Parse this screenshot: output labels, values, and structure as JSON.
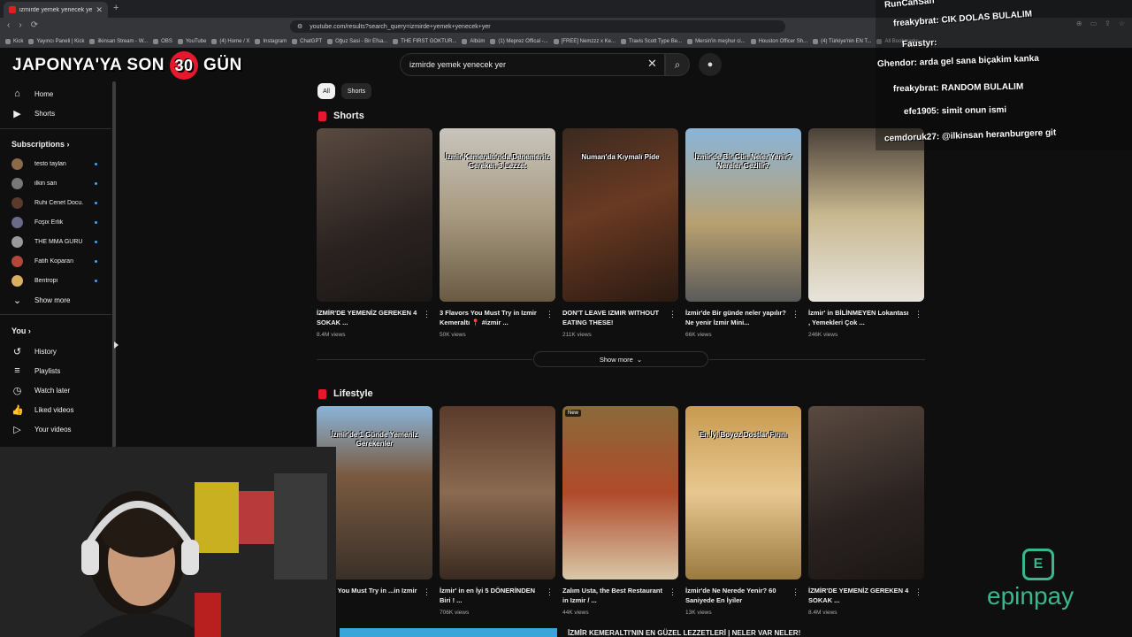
{
  "browser": {
    "tab_title": "izmirde yemek yenecek yer - YouTube",
    "new_tab": "+",
    "url": "youtube.com/results?search_query=izmirde+yemek+yenecek+yer",
    "nav": {
      "back": "‹",
      "forward": "›",
      "reload": "⟳"
    },
    "bookmarks": [
      "Kick",
      "Yayıncı Paneli | Kick",
      "ilkinsan Stream - W...",
      "OBS",
      "YouTube",
      "(4) Home / X",
      "Instagram",
      "ChatGPT",
      "Oğuz Sasi - Bir Efsa...",
      "THE FIRST GOKTUR...",
      "Albüm",
      "(1) Meprez Offical -...",
      "[FREE] Nemzzz x Ke...",
      "Travis Scott Type Be...",
      "Mersin'in meşhur ci...",
      "Houston Officer Sh...",
      "(4) Türkiye'nin EN T...",
      "All Bookmarks"
    ]
  },
  "overlay": {
    "title_left": "JAPONYA'YA SON",
    "title_number": "30",
    "title_right": "GÜN"
  },
  "search": {
    "query": "izmirde yemek yenecek yer",
    "clear": "✕",
    "search_icon": "⌕",
    "mic_icon": "🎤"
  },
  "sidebar": {
    "home": "Home",
    "shorts": "Shorts",
    "subscriptions": "Subscriptions",
    "subs": [
      {
        "name": "testo taylan",
        "color": "#8a6a4a"
      },
      {
        "name": "ilkin san",
        "color": "#777777"
      },
      {
        "name": "Ruhi Cenet Docu...",
        "color": "#5a3a2a"
      },
      {
        "name": "Foşix Erlik",
        "color": "#6a6a8a"
      },
      {
        "name": "THE MMA GURU",
        "color": "#9a9a9a"
      },
      {
        "name": "Fatih Koparan",
        "color": "#b4463a"
      },
      {
        "name": "Bentropi",
        "color": "#d8b060"
      }
    ],
    "show_more": "Show more",
    "you": "You",
    "you_items": [
      "History",
      "Playlists",
      "Watch later",
      "Liked videos",
      "Your videos"
    ]
  },
  "chips": {
    "all": "All",
    "shorts": "Shorts"
  },
  "sections": {
    "shorts_title": "Shorts",
    "lifestyle_title": "Lifestyle"
  },
  "shorts": [
    {
      "title": "İZMİR'DE YEMENİZ GEREKEN 4 SOKAK ...",
      "views": "8.4M views",
      "caption": "",
      "bg": "linear-gradient(160deg,#5a4a40,#2a2220 60%,#1a1614)"
    },
    {
      "title": "3 Flavors You Must Try in Izmir Kemeraltı 📍 #izmir ...",
      "views": "50K views",
      "caption": "İzmir Kemeraltı'nda Denemeniz Gereken 3 Lezzet",
      "bg": "linear-gradient(180deg,#c8c4bc,#a89a80 50%,#6a5a44)"
    },
    {
      "title": "DON'T LEAVE IZMIR WITHOUT EATING THESE!",
      "views": "211K views",
      "caption": "Numan'da Kıymalı Pide",
      "bg": "linear-gradient(160deg,#3a2a20,#6a3a22 45%,#2a1a12)"
    },
    {
      "title": "İzmir'de Bir günde neler yapılır? Ne yenir İzmir Mini...",
      "views": "66K views",
      "caption": "İzmir'de Bir Gün Neler Yenir? Nereler Gezilir?",
      "bg": "linear-gradient(180deg,#8ab4d8,#b8a070 55%,#5a5a5a)"
    },
    {
      "title": "İzmir' in BİLİNMEYEN Lokantası , Yemekleri Çok ...",
      "views": "246K views",
      "caption": "",
      "bg": "linear-gradient(180deg,#4a4038,#c8b890 50%,#e8e4dc)"
    }
  ],
  "show_more_btn": "Show more",
  "lifestyle": [
    {
      "title": "...ings You Must Try in ...in Izmir ...",
      "views": "...iews",
      "caption": "İzmir'de 1 Günde Yemeniz Gerekenler",
      "bg": "linear-gradient(180deg,#8ab4d8,#7a5a40 40%,#3a3028)",
      "badge": ""
    },
    {
      "title": "İzmir' in en İyi 5 DÖNERİNDEN Biri ! ...",
      "views": "706K views",
      "caption": "",
      "bg": "linear-gradient(180deg,#5a3a2a,#8a6a50 50%,#3a2a20)",
      "badge": ""
    },
    {
      "title": "Zalım Usta, the Best Restaurant in Izmir / ...",
      "views": "44K views",
      "caption": "",
      "bg": "linear-gradient(180deg,#8a6a3a,#b04a2a 50%,#d8c8a8)",
      "badge": "New"
    },
    {
      "title": "İzmir'de Ne Nerede Yenir? 60 Saniyede En İyiler",
      "views": "13K views",
      "caption": "En İyi Boyoz Dostlar Fırını",
      "bg": "linear-gradient(180deg,#c89a50,#e8c890 50%,#9a7a40)",
      "badge": ""
    },
    {
      "title": "İZMİR'DE YEMENİZ GEREKEN 4 SOKAK ...",
      "views": "8.4M views",
      "caption": "",
      "bg": "linear-gradient(160deg,#5a4a40,#2a2220 60%,#1a1614)",
      "badge": ""
    }
  ],
  "bottom_title": "İZMİR KEMERALTI'NIN EN GÜZEL LEZZETLERİ | NELER VAR NELER!",
  "chat": [
    {
      "user": "RunCanSan",
      "text": ""
    },
    {
      "user": "freakybrat:",
      "text": "CIK DOLAS BULALIM"
    },
    {
      "user": "Faustyr:",
      "text": ""
    },
    {
      "user": "Ghendor:",
      "text": "arda gel sana biçakim kanka"
    },
    {
      "user": "freakybrat:",
      "text": "RANDOM BULALIM"
    },
    {
      "user": "efe1905:",
      "text": "simit onun ismi"
    },
    {
      "user": "cemdoruk27:",
      "text": "@ilkinsan heranburgere git"
    }
  ],
  "sponsor": {
    "name": "epinpay",
    "logo_letter": "E"
  },
  "accent": "#e8182c",
  "link_blue": "#3ea6ff"
}
